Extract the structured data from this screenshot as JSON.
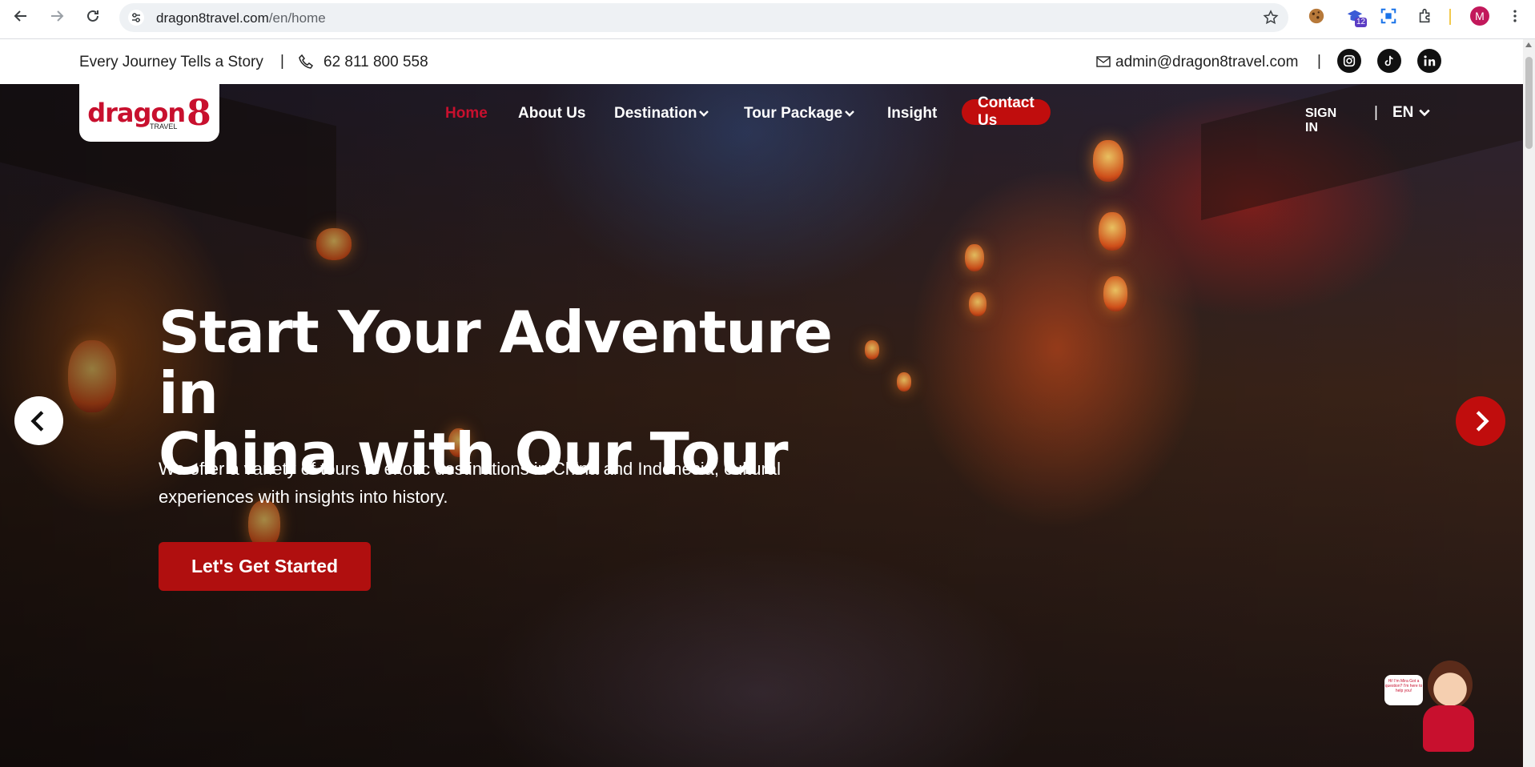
{
  "browser": {
    "url_domain": "dragon8travel.com",
    "url_path": "/en/home",
    "extension_badge": "12",
    "profile_initial": "M"
  },
  "topbar": {
    "tagline": "Every Journey Tells a Story",
    "separator": "|",
    "phone": "62 811 800 558",
    "email": "admin@dragon8travel.com",
    "socials": [
      "instagram-icon",
      "tiktok-icon",
      "linkedin-icon"
    ]
  },
  "logo": {
    "word": "dragon",
    "mark": "8",
    "sub": "TRAVEL"
  },
  "nav": {
    "items": [
      {
        "label": "Home"
      },
      {
        "label": "About Us"
      },
      {
        "label": "Destination"
      },
      {
        "label": "Tour Package"
      },
      {
        "label": "Insight"
      }
    ],
    "contact": "Contact Us",
    "signin": "SIGN IN",
    "pipe": "|",
    "lang": "EN"
  },
  "hero": {
    "headline_line1": "Start Your Adventure in",
    "headline_line2": "China with Our Tour",
    "subtext": "We offer a variety of tours to exotic destinations in China and Indonesia, cultural experiences with insights into history.",
    "cta": "Let's Get Started"
  },
  "chat": {
    "bubble_text": "Hi! I'm Mira Got a question? I'm here to help you!"
  },
  "colors": {
    "brand_red": "#c8102e",
    "button_red": "#c00d0d"
  }
}
